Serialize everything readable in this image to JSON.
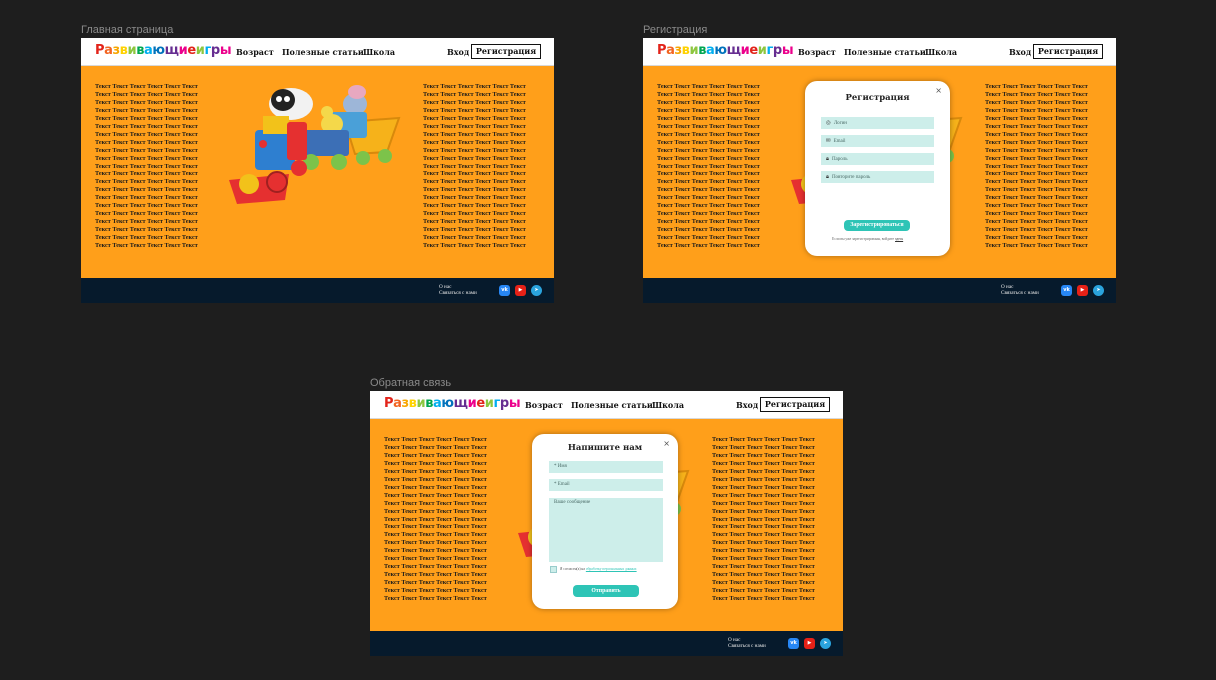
{
  "colors": {
    "canvas_bg": "#1e1e1e",
    "page_bg": "#ff9f1a",
    "header_bg": "#ffffff",
    "footer_bg": "#061a2c",
    "accent": "#2ec4b6",
    "field_bg": "#cdeeea",
    "logo_letters": [
      "#e2231a",
      "#f26522",
      "#f7a600",
      "#ffd200",
      "#8dc63f",
      "#00a651",
      "#00aeef",
      "#0072bc",
      "#662d91",
      "#ec008c",
      "#e2231a",
      "#f26522",
      "#8dc63f",
      "#00aeef",
      "#662d91",
      "#ec008c"
    ]
  },
  "frames": [
    {
      "label": "Главная страница"
    },
    {
      "label": "Регистрация"
    },
    {
      "label": "Обратная связь"
    }
  ],
  "header": {
    "logo": "Развивающие игры",
    "nav_age": "Возраст",
    "nav_articles": "Полезные статьи",
    "nav_school": "Школа",
    "login": "Вход",
    "register": "Регистрация"
  },
  "body_text_line": "Текст Текст Текст Текст Текст Текст",
  "body_text_lines": 21,
  "footer": {
    "about": "О нас",
    "contact": "Связаться с нами",
    "icons": [
      "vk-icon",
      "youtube-icon",
      "telegram-icon"
    ]
  },
  "registration_modal": {
    "title": "Регистрация",
    "close": "×",
    "login_placeholder": "Логин",
    "email_placeholder": "Email",
    "password_placeholder": "Пароль",
    "repeat_password_placeholder": "Повторите пароль",
    "submit": "Зарегистрироваться",
    "hint": "Если вы уже зарегистрированы, войдите",
    "hint_link": "здесь"
  },
  "feedback_modal": {
    "title": "Напишите нам",
    "close": "×",
    "name_placeholder": "* Имя",
    "email_placeholder": "* Email",
    "message_placeholder": "Ваше сообщение",
    "consent": "Я согласен(а) на",
    "consent_link": "обработку персональных данных",
    "submit": "Отправить"
  }
}
